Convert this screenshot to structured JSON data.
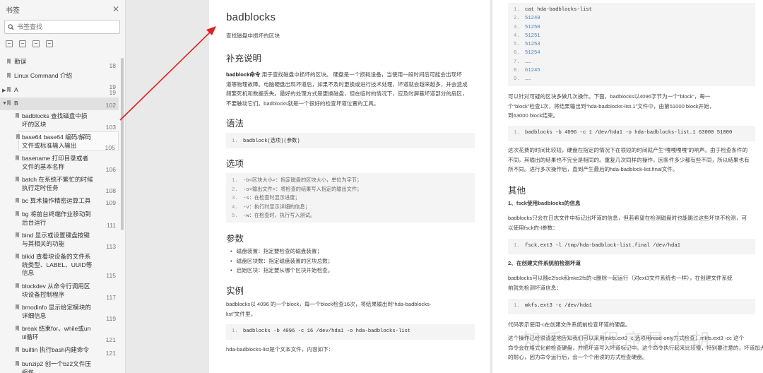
{
  "sidebar": {
    "title": "书签",
    "search_placeholder": "书签查找",
    "items": [
      {
        "label": "勘误",
        "page": "18"
      },
      {
        "label": "Linux Command 介绍",
        "page": "19"
      },
      {
        "label": "A",
        "page": "19"
      },
      {
        "label": "B",
        "page": "102"
      },
      {
        "label": "badblocks 查找磁盘中损\n坏的区块",
        "page": "103"
      },
      {
        "label": "base64 base64 编码/解码\n文件或标准输入输出",
        "page": "105"
      },
      {
        "label": "basename 打印目录或者\n文件的基本名称",
        "page": "106"
      },
      {
        "label": "batch 在系统不繁忙的时候\n执行定时任务",
        "page": "108"
      },
      {
        "label": "bc 算术操作精密运算工具",
        "page": "109"
      },
      {
        "label": "bg 将前台终端作业移动到\n后台运行",
        "page": "111"
      },
      {
        "label": "bind 显示或设置键盘按键\n与其相关的功能",
        "page": "113"
      },
      {
        "label": "blkid 查看块设备的文件系\n统类型、LABEL、UUID等\n信息",
        "page": "115"
      },
      {
        "label": "blockdev 从命令行调用区\n块设备控制程序",
        "page": "117"
      },
      {
        "label": "bmodinfo 显示给定模块的\n详细信息",
        "page": "119"
      },
      {
        "label": "break 结束for、while或un\ntil循环",
        "page": "121"
      },
      {
        "label": "builtin 执行bash内建命令",
        "page": "121"
      },
      {
        "label": "bunzip2 创一个bz2文件压\n缩包",
        "page": ""
      }
    ]
  },
  "page1": {
    "title": "badblocks",
    "subtitle": "查找磁盘中损坏的区块",
    "s_intro": "补充说明",
    "intro_bold": "badblock命令",
    "intro_rest_1": " 用于查找磁盘中损坏的区块。 硬盘是一个损耗设备，当使用一段时间后可能会出现坏",
    "intro_2": "道等物理故障。电脑硬盘出现坏道后，如果不及时更换或进行技术处理，坏道就会越来越多，并会造成",
    "intro_3": "频繁死机和数据丢失。最好的处理方式是更换磁盘，但在临时的情况下，应及时屏蔽坏道部分的扇区，",
    "intro_4": "不要触动它们。badblocks就是一个很好的检查坏道位置的工具。",
    "s_syntax": "语法",
    "syntax_code": "badblock(选项)(参数)",
    "s_options": "选项",
    "options": [
      "-b<区块大小>：指定磁盘的区块大小，单位为字节；",
      "-o<输出文件>：将检查的结果写入指定的输出文件；",
      "-s：在检查时显示进度；",
      "-v：执行时显示详细的信息；",
      "-w：在检查时，执行写入测试。"
    ],
    "s_params": "参数",
    "params": [
      "磁盘装置：指定要检查的磁盘装置；",
      "磁盘区块数：指定磁盘装置的区块总数；",
      "启始区块：指定要从哪个区块开始检查。"
    ],
    "s_example": "实例",
    "example_1": "badblocks以 4096 的一个block，每一个block检查16次，将结果输出到“hda-badblocks-",
    "example_2": "list”文件里。",
    "example_code": "badblocks -b 4096 -c 16 /dev/hda1 -o hda-badblocks-list",
    "example_after": "hda-badblocks-list是个文本文件，内容如下："
  },
  "page2": {
    "code_lines": [
      "cat hda-badblocks-list",
      "51249",
      "51250",
      "51251",
      "51253",
      "51254",
      "……",
      "61245",
      "……"
    ],
    "p1_1": "可以针对可疑的区块多做几次操作。下面，badblocks以4096字节为一个“block”，每一",
    "p1_2": "个“block”检查1次，将结果输出到“hda-badblocks-list.1”文件中，由第51000 block开始，",
    "p1_3": "到63000 block结束。",
    "code2": "badblocks -b 4096 -c 1 /dev/hda1 -o hda-badblocks-list.1 63000 51000",
    "p2_1": "这次花费的时间比较短，硬盘在指定的情况下在很短的时间就产生“嘎嘎嘎嘎”的响声。由于检查条件的",
    "p2_2": "不同，其输出的结果也不完全是相同的。重复几次同样的操作，因条件多少都有些不同，所以结果也有",
    "p2_3": "所不同。进行多次操作后，直到产生最后的hda-badblock-list.final文件。",
    "s_other": "其他",
    "sub1": "1、fsck使用badblocks的信息",
    "p3_1": "badblocks只会在日志文件中标记出坏道的信息，但若希望在检测磁盘时也能跳过这些坏块不检测，可",
    "p3_2": "以使用fsck的-l参数：",
    "code3": "fsck.ext3 -l /tmp/hda-badblock-list.final /dev/hda1",
    "sub2": "2、在创建文件系统前检测坏道",
    "p4_1": "badblocks可以随e2fsck和mke2fs的-c删除一起运行（对ext3文件系统也一样），在创建文件系统",
    "p4_2": "前就先检测坏道信息：",
    "code4": "mkfs.ext3 -c /dev/hda1",
    "p5": "代码表示使用-c在创建文件系统前检查坏道的硬盘。",
    "p6_1": "这个操作已经很清楚地告知我们可以采用mkfs.ext3 -c 选项用read-only方式检查；mkfs.ext3 -cc 这个",
    "p6_2": "命令会在格式化前检查硬盘，并把坏道写入坏道标记中。这个命令执行起来比较慢，特别要注意的，坏道加大",
    "p6_3": "的耐心，因为命令运行后，会一个个用读的方式检查硬盘。"
  },
  "watermark": "知乎 @程序员小胡",
  "colors": {
    "arrow": "#e02020",
    "number": "#4a7fb8"
  }
}
